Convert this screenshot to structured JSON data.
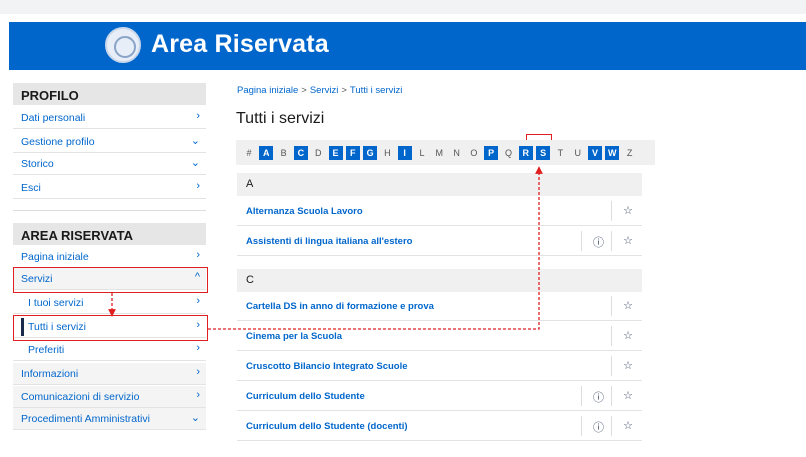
{
  "header": {
    "title": "Area Riservata"
  },
  "sidebar": {
    "profilo": {
      "heading": "PROFILO",
      "items": [
        {
          "label": "Dati personali",
          "chevron": "›"
        },
        {
          "label": "Gestione profilo",
          "chevron": "⌄"
        },
        {
          "label": "Storico",
          "chevron": "⌄"
        },
        {
          "label": "Esci",
          "chevron": "›"
        }
      ]
    },
    "area": {
      "heading": "AREA RISERVATA",
      "items": [
        {
          "label": "Pagina iniziale",
          "chevron": "›"
        },
        {
          "label": "Servizi",
          "chevron": "^"
        },
        {
          "label": "I tuoi servizi",
          "chevron": "›"
        },
        {
          "label": "Tutti i servizi",
          "chevron": "›"
        },
        {
          "label": "Preferiti",
          "chevron": "›"
        },
        {
          "label": "Informazioni",
          "chevron": "›"
        },
        {
          "label": "Comunicazioni di servizio",
          "chevron": "›"
        },
        {
          "label": "Procedimenti Amministrativi",
          "chevron": "⌄"
        }
      ]
    }
  },
  "breadcrumb": {
    "home": "Pagina iniziale",
    "sep": ">",
    "servizi": "Servizi",
    "current": "Tutti i servizi"
  },
  "page": {
    "title": "Tutti i servizi"
  },
  "alphabet": [
    {
      "l": "#",
      "on": false
    },
    {
      "l": "A",
      "on": true
    },
    {
      "l": "B",
      "on": false
    },
    {
      "l": "C",
      "on": true
    },
    {
      "l": "D",
      "on": false
    },
    {
      "l": "E",
      "on": true
    },
    {
      "l": "F",
      "on": true
    },
    {
      "l": "G",
      "on": true
    },
    {
      "l": "H",
      "on": false
    },
    {
      "l": "I",
      "on": true
    },
    {
      "l": "L",
      "on": false
    },
    {
      "l": "M",
      "on": false
    },
    {
      "l": "N",
      "on": false
    },
    {
      "l": "O",
      "on": false
    },
    {
      "l": "P",
      "on": true
    },
    {
      "l": "Q",
      "on": false
    },
    {
      "l": "R",
      "on": true
    },
    {
      "l": "S",
      "on": true
    },
    {
      "l": "T",
      "on": false
    },
    {
      "l": "U",
      "on": false
    },
    {
      "l": "V",
      "on": true
    },
    {
      "l": "W",
      "on": true
    },
    {
      "l": "Z",
      "on": false
    }
  ],
  "sections": [
    {
      "letter": "A",
      "services": [
        {
          "name": "Alternanza Scuola Lavoro",
          "info": false
        },
        {
          "name": "Assistenti di lingua italiana all'estero",
          "info": true
        }
      ]
    },
    {
      "letter": "C",
      "services": [
        {
          "name": "Cartella DS in anno di formazione e prova",
          "info": false
        },
        {
          "name": "Cinema per la Scuola",
          "info": false
        },
        {
          "name": "Cruscotto Bilancio Integrato Scuole",
          "info": false
        },
        {
          "name": "Curriculum dello Studente",
          "info": true
        },
        {
          "name": "Curriculum dello Studente (docenti)",
          "info": true
        }
      ]
    }
  ],
  "icons": {
    "star": "☆",
    "info": "ⓘ"
  },
  "colors": {
    "brand": "#0066cc",
    "highlight": "#e02020",
    "sidebar_heading_bg": "#e6e6e6"
  }
}
